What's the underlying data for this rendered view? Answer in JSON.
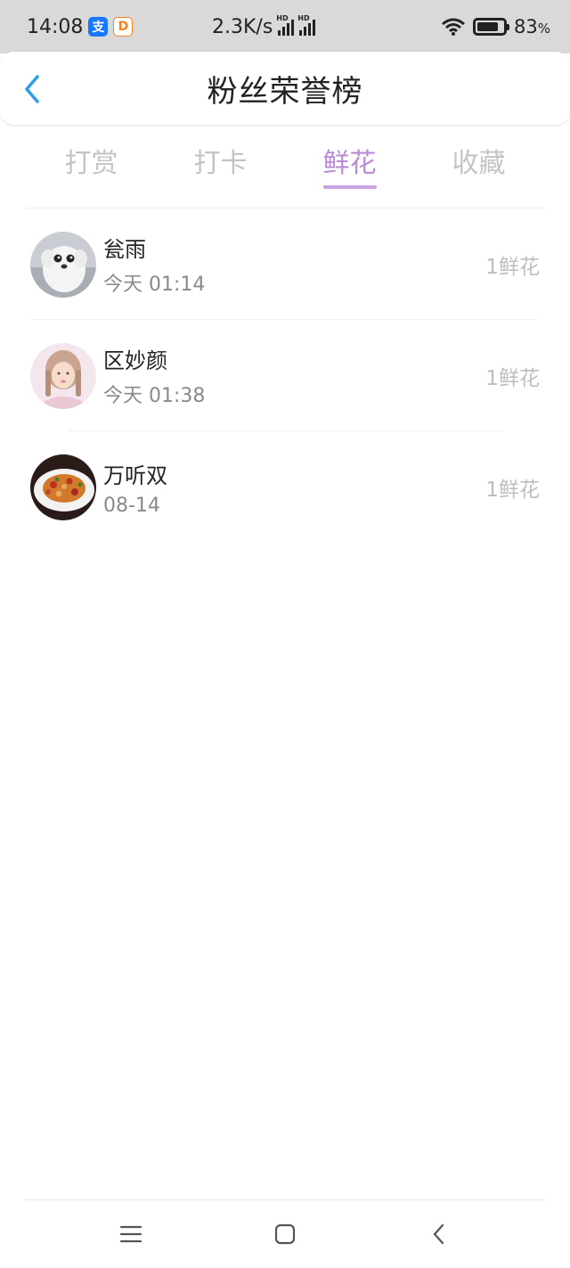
{
  "status_bar": {
    "time": "14:08",
    "network_speed": "2.3K/s",
    "battery_percent": "83",
    "battery_unit": "%",
    "battery_level": 0.83,
    "apps": [
      {
        "icon": "alipay-icon",
        "glyph": "支",
        "color": "#1677ff"
      },
      {
        "icon": "didi-icon",
        "glyph": "D",
        "color": "#f58220"
      }
    ]
  },
  "header": {
    "title": "粉丝荣誉榜",
    "back_icon": "chevron-left-icon",
    "accent_color": "#2a9ee8"
  },
  "tabs": [
    {
      "label": "打赏",
      "active": false
    },
    {
      "label": "打卡",
      "active": false
    },
    {
      "label": "鲜花",
      "active": true
    },
    {
      "label": "收藏",
      "active": false
    }
  ],
  "active_color": "#b98ad6",
  "fans": [
    {
      "name": "瓮雨",
      "time": "今天 01:14",
      "count": "1鲜花",
      "avatar": "white-dog-avatar"
    },
    {
      "name": "区妙颜",
      "time": "今天 01:38",
      "count": "1鲜花",
      "avatar": "girl-photo-avatar"
    },
    {
      "name": "万听双",
      "time": "08-14",
      "count": "1鲜花",
      "avatar": "food-dish-avatar"
    }
  ],
  "nav_bar": {
    "menu_icon": "menu-icon",
    "home_icon": "home-square-icon",
    "back_icon": "back-arrow-icon"
  }
}
